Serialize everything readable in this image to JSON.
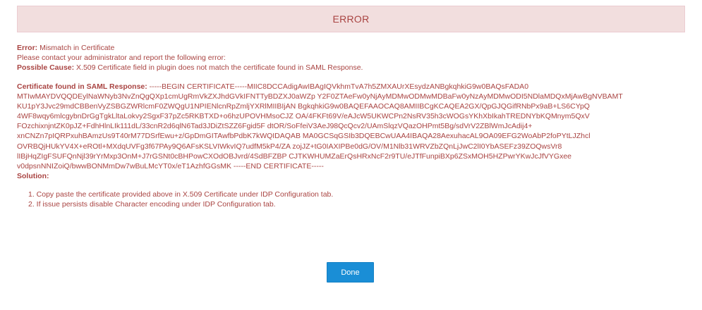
{
  "banner": {
    "title": "ERROR"
  },
  "error": {
    "label": "Error:",
    "text": " Mismatch in Certificate"
  },
  "contact": {
    "text": "Please contact your administrator and report the following error:"
  },
  "cause": {
    "label": "Possible Cause:",
    "text": " X.509 Certificate field in plugin does not match the certificate found in SAML Response."
  },
  "certificate": {
    "label": "Certificate found in SAML Response:",
    "lines": [
      " -----BEGIN CERTIFICATE-----MIIC8DCCAdigAwIBAgIQVkhmTvA7h5ZMXAUrXEsydzANBgkqhkiG9w0BAQsFADA0",
      "MTIwMAYDVQQDEylNaWNyb3NvZnQgQXp1cmUgRmVkZXJhdGVkIFNTTyBDZXJ0aWZp Y2F0ZTAeFw0yNjAyMDMwODMwMDBaFw0yNzAyMDMwODI5NDlaMDQxMjAwBgNVBAMT",
      "KU1pY3Jvc29mdCBBenVyZSBGZWRlcmF0ZWQgU1NPIENlcnRpZmljYXRlMIIBIjAN BgkqhkiG9w0BAQEFAAOCAQ8AMIIBCgKCAQEA2GX/QpGJQGifRNbPx9aB+LS6CYpQ",
      "4WF8wqy6mlcgybnDrGgTgkLltaLokvy2SgxF37pZc5RKBTXD+o6hzUPOVHMsoCJZ OA/4FKFt69V/eAJcW5UKWCPn2NsRV35h3cWOGsYKhXbIkahTREDNYbKQMnym5QxV",
      "FOzchixnjntZK0pJZ+FdhHlnLIk111dL/33cnR2d6qlN6Tad3JDiZtSZZ6Fgid5F dtOR/SoFfeiV3AeJ98QcQcv2/UAmSlqzVQazOHPmt5Bg/sdVrV2ZBlWmJcAdij4+",
      "xnCNZn7pIQRPxuhBAmzUs9T40rM77DSrfEwu+z/GpDmGITAwfbPdbK7kWQIDAQAB MA0GCSqGSIb3DQEBCwUAA4IBAQA28AexuhacAL9OA09EFG2WoAbP2foPYtLJZhcl",
      "OVRBQjHUkYV4X+eROtl+MXdqUVFg3f67PAy9Q6AFsKSLVIWkvIQ7udfM5kP4/ZA zojJZ+tG0IAXIPBe0dG/OV/M1Nlb31WRVZbZQnLjJwC2lI0YbASEFz39ZOQwsVr8",
      "lIBjHqZIgFSUFQnNjl39rYrMxp3OnM+J7rGSNt0cBHPowCXOdOBJvrd/4SdBFZBP CJTKWHUMZaErQsHRxNcF2r9TU/eJTfFunpiBXp6ZSxMOH5HZPwrYKwJcJfVYGxee",
      "v0dpsnNNIZoiQ/bwwBONMmDw7wBuLMcYT0x/eT1AzhfGGsMK -----END CERTIFICATE-----"
    ]
  },
  "solution": {
    "label": "Solution:",
    "steps": [
      "1. Copy paste the certificate provided above in X.509 Certificate under IDP Configuration tab.",
      "2. If issue persists disable Character encoding under IDP Configuration tab."
    ]
  },
  "actions": {
    "done_label": "Done"
  },
  "colors": {
    "error_text": "#a94442",
    "banner_bg": "#f2dede",
    "banner_border": "#ebccd1",
    "button_bg": "#1a8ed6",
    "button_text": "#ffffff"
  }
}
